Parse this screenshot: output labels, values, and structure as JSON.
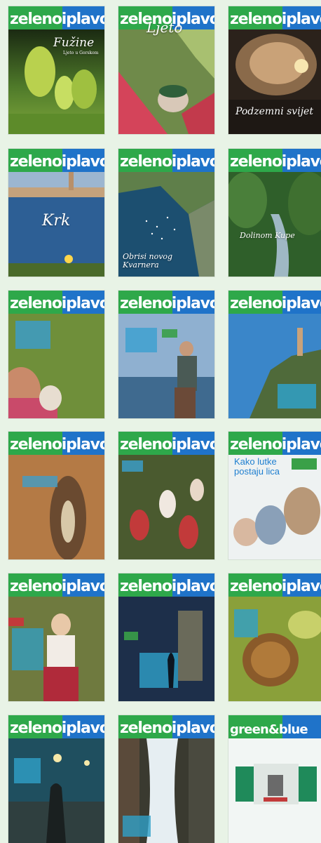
{
  "covers": [
    {
      "logo": "zelenoiplavo",
      "title": "Fužine",
      "subtitle": "Ljeto u Gorskom"
    },
    {
      "logo": "zelenoiplavo",
      "title": "Ljeto"
    },
    {
      "logo": "zelenoiplavo",
      "title": "Podzemni svijet"
    },
    {
      "logo": "zelenoiplavo",
      "title": "Krk"
    },
    {
      "logo": "zelenoiplavo",
      "title": "Obrisi novog Kvarnera"
    },
    {
      "logo": "zelenoiplavo",
      "title": "Dolinom Kupe"
    },
    {
      "logo": "zelenoiplavo",
      "title": ""
    },
    {
      "logo": "zelenoiplavo",
      "title": ""
    },
    {
      "logo": "zelenoiplavo",
      "title": ""
    },
    {
      "logo": "zelenoiplavo",
      "title": ""
    },
    {
      "logo": "zelenoiplavo",
      "title": ""
    },
    {
      "logo": "zelenoiplavo",
      "title": "Kako lutke postaju lica"
    },
    {
      "logo": "zelenoiplavo",
      "title": ""
    },
    {
      "logo": "zelenoiplavo",
      "title": ""
    },
    {
      "logo": "zelenoiplavo",
      "title": ""
    },
    {
      "logo": "zelenoiplavo",
      "title": ""
    },
    {
      "logo": "zelenoiplavo",
      "title": ""
    },
    {
      "logo": "green&blue",
      "title": ""
    }
  ],
  "colors": {
    "background": "#e8f3e6",
    "mast_green": "#2ea84a",
    "mast_blue": "#1f73c9"
  }
}
